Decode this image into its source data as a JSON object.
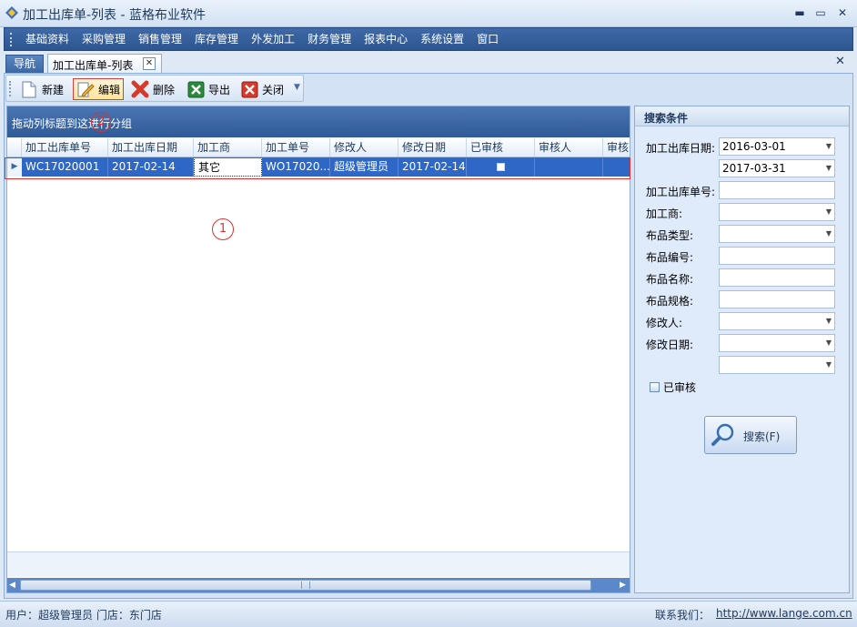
{
  "window": {
    "title": "加工出库单-列表 - 蓝格布业软件",
    "minimize": "▬",
    "restore": "▭",
    "close": "✕"
  },
  "menu": [
    "基础资料",
    "采购管理",
    "销售管理",
    "库存管理",
    "外发加工",
    "财务管理",
    "报表中心",
    "系统设置",
    "窗口"
  ],
  "tabs": {
    "nav": "导航",
    "active": "加工出库单-列表",
    "tab_close": "✕",
    "doc_close": "✕"
  },
  "toolbar": {
    "new": "新建",
    "edit": "编辑",
    "delete": "删除",
    "export": "导出",
    "close": "关闭",
    "more": "▼"
  },
  "grid": {
    "group_hint": "拖动列标题到这进行分组",
    "columns": [
      "加工出库单号",
      "加工出库日期",
      "加工商",
      "加工单号",
      "修改人",
      "修改日期",
      "已审核",
      "审核人",
      "审核"
    ],
    "rows": [
      {
        "order_no": "WC17020001",
        "order_date": "2017-02-14",
        "processor": "其它",
        "process_no": "WO17020...",
        "modifier": "超级管理员",
        "modify_date": "2017-02-14",
        "audited": false,
        "auditor": "",
        "audit": ""
      }
    ],
    "row_indicator": "▶"
  },
  "annotations": {
    "one": "1",
    "two": "2"
  },
  "search": {
    "title": "搜索条件",
    "fields": {
      "date_label": "加工出库日期:",
      "date_from": "2016-03-01",
      "date_to": "2017-03-31",
      "order_no_label": "加工出库单号:",
      "processor_label": "加工商:",
      "category_label": "布品类型:",
      "code_label": "布品编号:",
      "name_label": "布品名称:",
      "spec_label": "布品规格:",
      "modifier_label": "修改人:",
      "modify_date_label": "修改日期:"
    },
    "audited_label": "已审核",
    "button": "搜索(F)"
  },
  "status": {
    "user": "用户：超级管理员  门店：东门店",
    "contact_label": "联系我们：",
    "url": "http://www.lange.com.cn"
  },
  "colors": {
    "menu_bg": "#2d558f",
    "selected_row": "#2f67c7",
    "annotation": "#e03030"
  }
}
